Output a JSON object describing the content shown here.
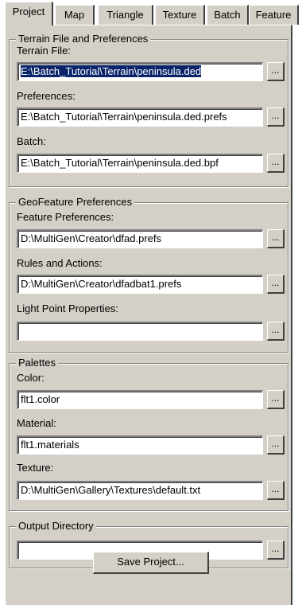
{
  "tabs": [
    "Project",
    "Map",
    "Triangle",
    "Texture",
    "Batch",
    "Feature"
  ],
  "active_tab": "Project",
  "browse_label": "...",
  "terrain": {
    "title": "Terrain File and Preferences",
    "terrain_file": {
      "label": "Terrain File:",
      "value": "E:\\Batch_Tutorial\\Terrain\\peninsula.ded"
    },
    "preferences": {
      "label": "Preferences:",
      "value": "E:\\Batch_Tutorial\\Terrain\\peninsula.ded.prefs"
    },
    "batch": {
      "label": "Batch:",
      "value": "E:\\Batch_Tutorial\\Terrain\\peninsula.ded.bpf"
    }
  },
  "geofeature": {
    "title": "GeoFeature Preferences",
    "feature_prefs": {
      "label": "Feature Preferences:",
      "value": "D:\\MultiGen\\Creator\\dfad.prefs"
    },
    "rules_actions": {
      "label": "Rules and Actions:",
      "value": "D:\\MultiGen\\Creator\\dfadbat1.prefs"
    },
    "light_point": {
      "label": "Light Point Properties:",
      "value": ""
    }
  },
  "palettes": {
    "title": "Palettes",
    "color": {
      "label": "Color:",
      "value": "flt1.color"
    },
    "material": {
      "label": "Material:",
      "value": "flt1.materials"
    },
    "texture": {
      "label": "Texture:",
      "value": "D:\\MultiGen\\Gallery\\Textures\\default.txt"
    }
  },
  "output": {
    "title": "Output Directory",
    "directory": {
      "value": ""
    }
  },
  "save_button": "Save Project..."
}
